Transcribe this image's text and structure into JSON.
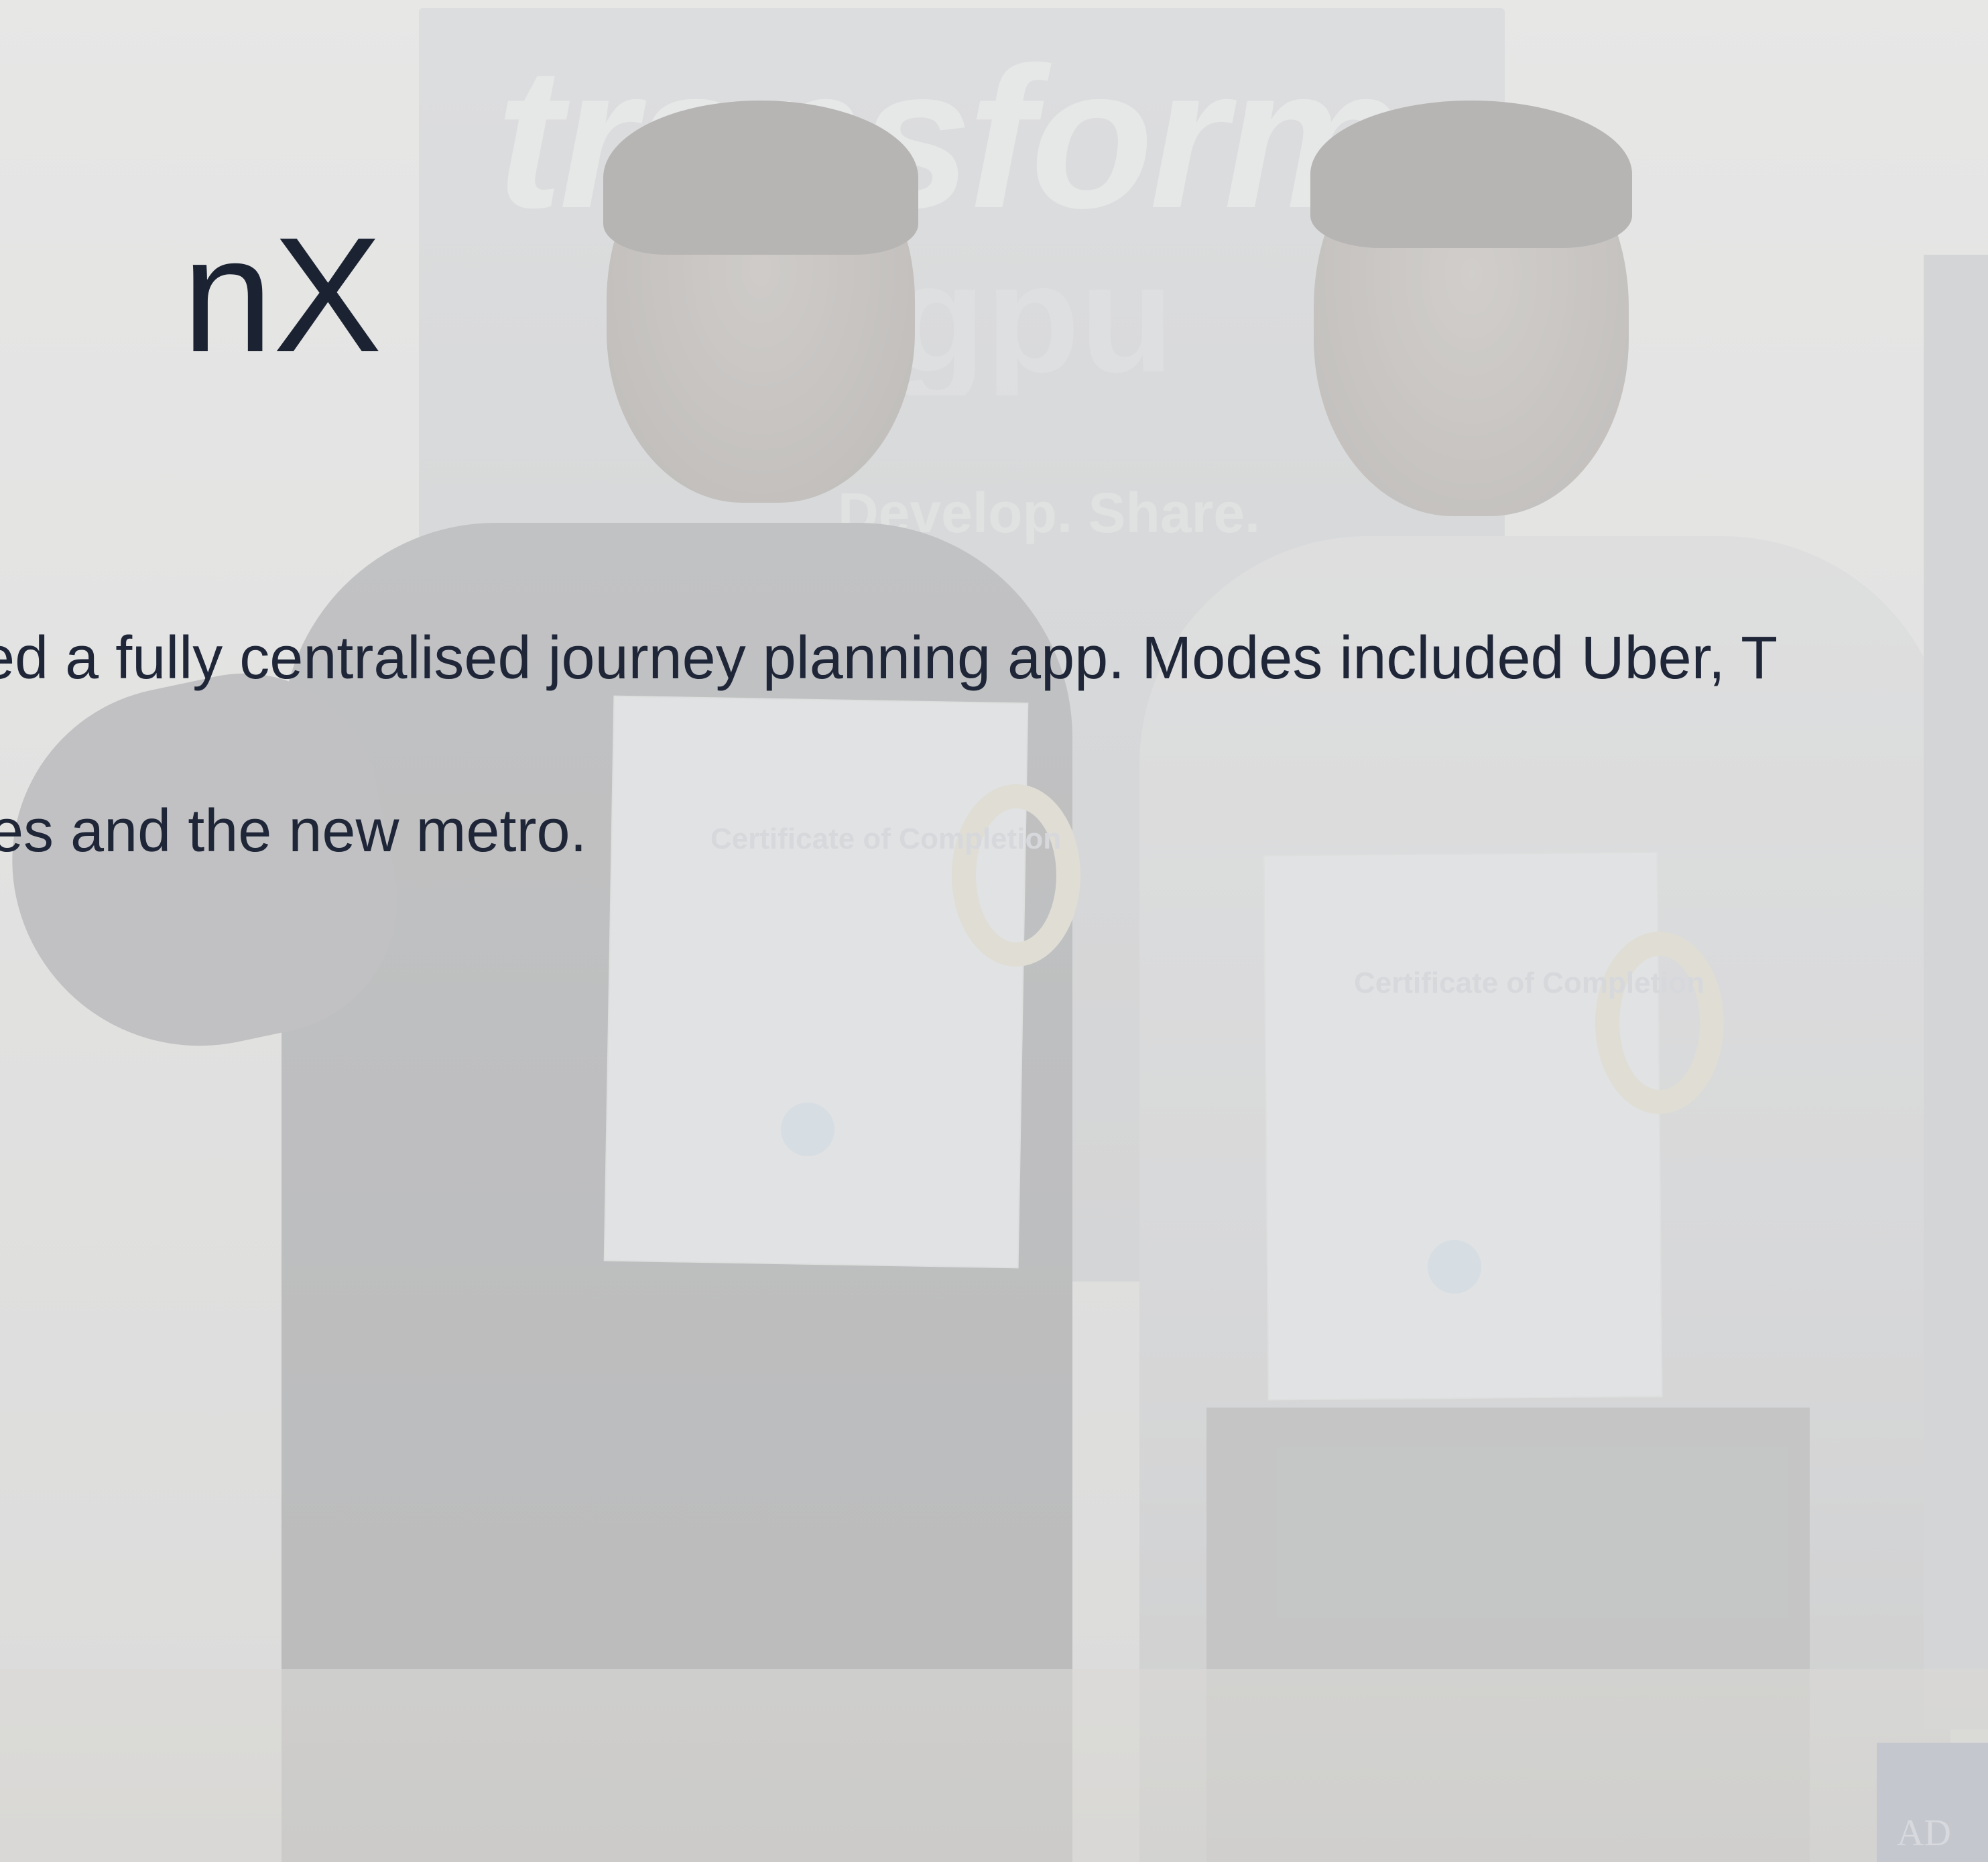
{
  "slide": {
    "title": "nX",
    "body_lines": [
      "ned a fully centralised journey planning app. Modes included Uber, T",
      "ses and the new metro."
    ]
  },
  "background_photo": {
    "poster_text": "transform",
    "poster_text_2": "gpu",
    "poster_tagline": "Develop. Share.",
    "certificate_1_title": "Certificate of Completion",
    "certificate_2_title": "Certificate of Completion",
    "sign_text": "AD"
  },
  "colors": {
    "text": "#1b2333",
    "veil": "#ececec"
  }
}
